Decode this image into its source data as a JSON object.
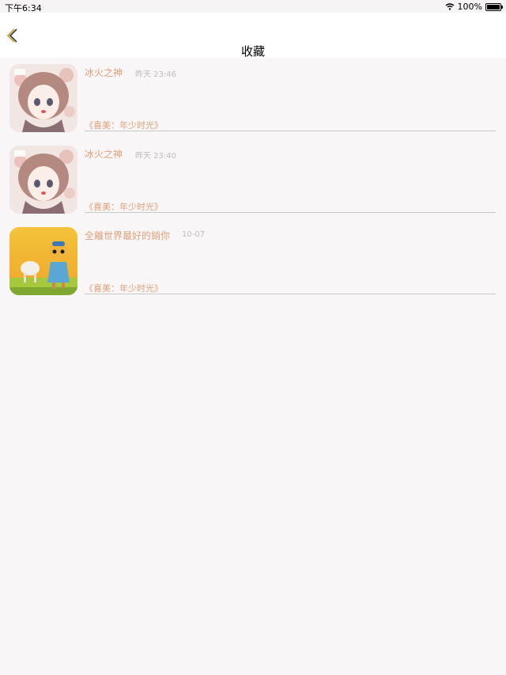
{
  "status": {
    "time": "下午6:34",
    "battery": "100%"
  },
  "nav": {
    "title": "收藏"
  },
  "items": [
    {
      "title": "冰火之神",
      "time": "昨天 23:46",
      "book": "《喜美：年少时光》",
      "thumb": "anime-girl"
    },
    {
      "title": "冰火之神",
      "time": "昨天 23:40",
      "book": "《喜美：年少时光》",
      "thumb": "anime-girl"
    },
    {
      "title": "全離世界最好的銷你",
      "time": "10-07",
      "book": "《喜美：年少时光》",
      "thumb": "figurine"
    }
  ],
  "colors": {
    "accent": "#e0a078",
    "muted": "#bdbdbd",
    "background": "#f9f6f8"
  }
}
